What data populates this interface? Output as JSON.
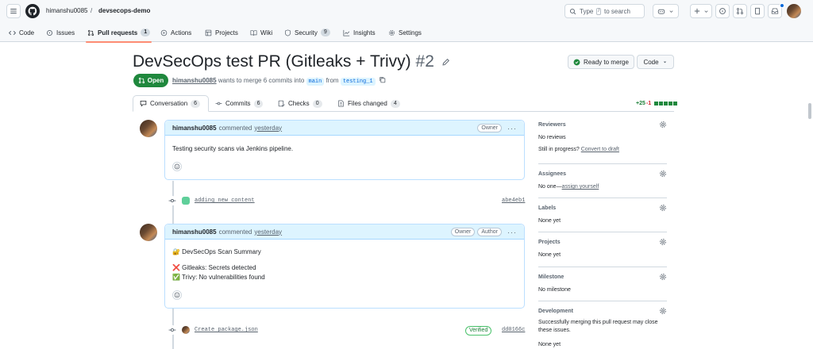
{
  "header": {
    "owner": "himanshu0085",
    "separator": "/",
    "repo": "devsecops-demo",
    "search_before": "Type",
    "search_key": "/",
    "search_after": "to search"
  },
  "tabs": [
    {
      "label": "Code",
      "icon": "code-icon"
    },
    {
      "label": "Issues",
      "icon": "issue-icon"
    },
    {
      "label": "Pull requests",
      "count": "1",
      "icon": "pull-request-icon"
    },
    {
      "label": "Actions",
      "icon": "play-icon"
    },
    {
      "label": "Projects",
      "icon": "table-icon"
    },
    {
      "label": "Wiki",
      "icon": "book-icon"
    },
    {
      "label": "Security",
      "count": "9",
      "icon": "shield-icon"
    },
    {
      "label": "Insights",
      "icon": "graph-icon"
    },
    {
      "label": "Settings",
      "icon": "gear-icon"
    }
  ],
  "pr": {
    "title": "DevSecOps test PR (Gitleaks + Trivy)",
    "number": "#2",
    "state": "Open",
    "author": "himanshu0085",
    "merge_text": "wants to merge 6 commits into",
    "base": "main",
    "from": "from",
    "head": "testing_1",
    "ready_label": "Ready to merge",
    "code_label": "Code"
  },
  "pr_tabs": [
    {
      "label": "Conversation",
      "count": "6"
    },
    {
      "label": "Commits",
      "count": "6"
    },
    {
      "label": "Checks",
      "count": "0"
    },
    {
      "label": "Files changed",
      "count": "4"
    }
  ],
  "diffstat": {
    "add": "+25",
    "del": "-1"
  },
  "timeline": {
    "comment1": {
      "author": "himanshu0085",
      "action": "commented",
      "when": "yesterday",
      "badge": "Owner",
      "body": "Testing security scans via Jenkins pipeline."
    },
    "commit1": {
      "message": "adding new content",
      "sha": "abe4eb1"
    },
    "comment2": {
      "author": "himanshu0085",
      "action": "commented",
      "when": "yesterday",
      "badge1": "Owner",
      "badge2": "Author",
      "line1": "🔐 DevSecOps Scan Summary",
      "line2": "❌ Gitleaks: Secrets detected",
      "line3": "✅ Trivy: No vulnerabilities found"
    },
    "commit2": {
      "message": "Create package.json",
      "verified": "Verified",
      "sha": "dd0166c"
    }
  },
  "sidebar": {
    "reviewers": {
      "title": "Reviewers",
      "value": "No reviews",
      "progress_prefix": "Still in progress?",
      "progress_link": "Convert to draft"
    },
    "assignees": {
      "title": "Assignees",
      "prefix": "No one—",
      "link": "assign yourself"
    },
    "labels": {
      "title": "Labels",
      "value": "None yet"
    },
    "projects": {
      "title": "Projects",
      "value": "None yet"
    },
    "milestone": {
      "title": "Milestone",
      "value": "No milestone"
    },
    "development": {
      "title": "Development",
      "value": "Successfully merging this pull request may close these issues.",
      "value2": "None yet"
    }
  },
  "colors": {
    "accent": "#0969da",
    "open": "#1f883d",
    "tab_underline": "#fd8c73"
  }
}
